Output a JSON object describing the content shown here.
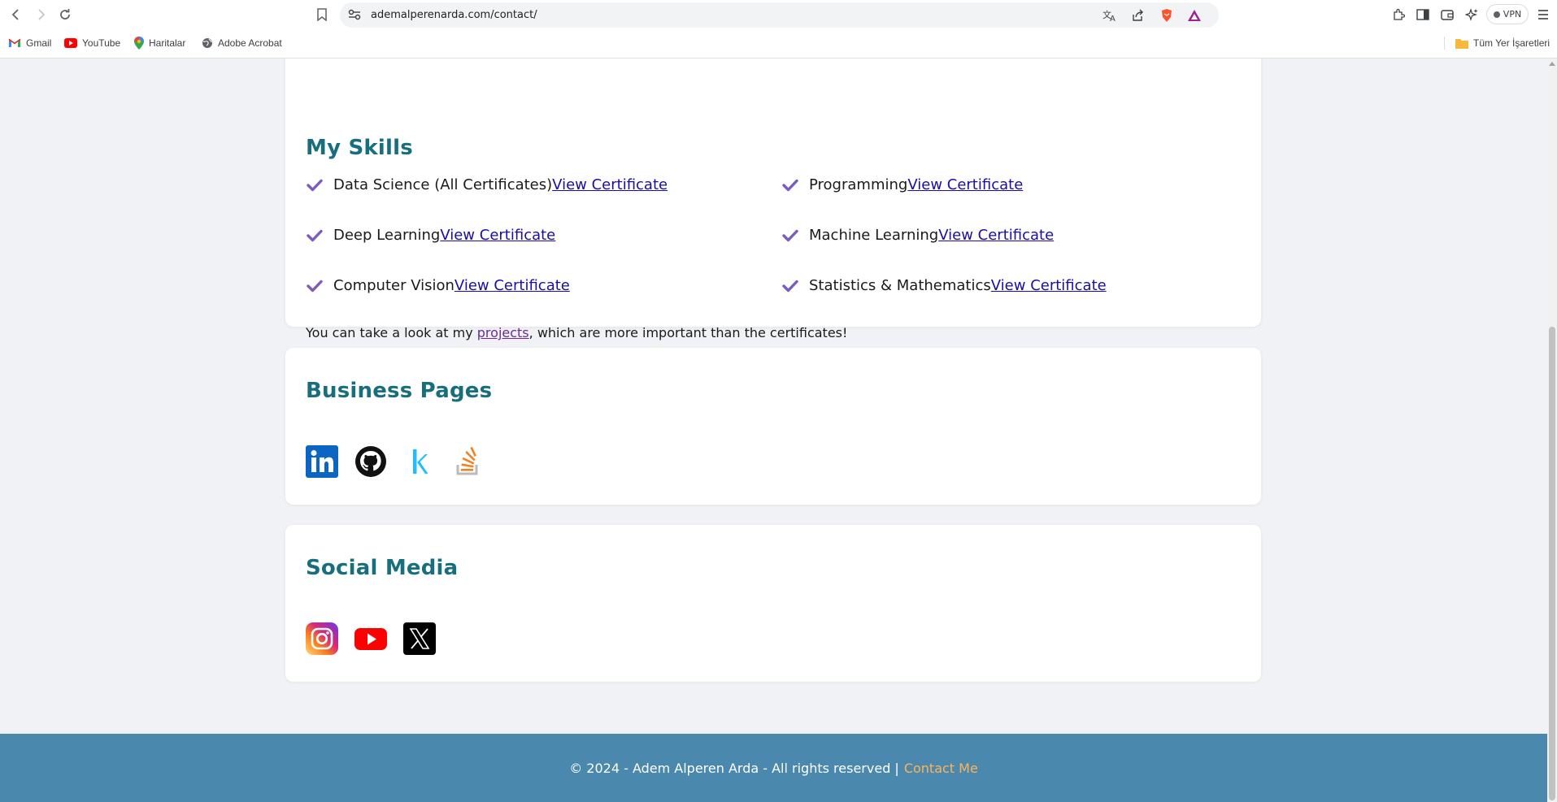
{
  "browser": {
    "url": "ademalperenarda.com/contact/",
    "vpn_label": "VPN",
    "bookmarks": [
      {
        "label": "Gmail"
      },
      {
        "label": "YouTube"
      },
      {
        "label": "Haritalar"
      },
      {
        "label": "Adobe Acrobat"
      }
    ],
    "all_bookmarks_label": "Tüm Yer İşaretleri"
  },
  "skills": {
    "title": "My Skills",
    "items": [
      {
        "name": "Data Science (All Certificates)",
        "link": "View Certificate"
      },
      {
        "name": "Programming",
        "link": "View Certificate"
      },
      {
        "name": "Deep Learning",
        "link": "View Certificate"
      },
      {
        "name": "Machine Learning",
        "link": "View Certificate"
      },
      {
        "name": "Computer Vision",
        "link": "View Certificate"
      },
      {
        "name": "Statistics & Mathematics",
        "link": "View Certificate"
      }
    ],
    "note_prefix": "You can take a look at my ",
    "note_link": "projects",
    "note_suffix": ", which are more important than the certificates!"
  },
  "business": {
    "title": "Business Pages",
    "icons": [
      "linkedin-icon",
      "github-icon",
      "kaggle-icon",
      "stackoverflow-icon"
    ]
  },
  "social": {
    "title": "Social Media",
    "icons": [
      "instagram-icon",
      "youtube-icon",
      "x-icon"
    ]
  },
  "footer": {
    "text": "© 2024 - Adem Alperen Arda - All rights reserved |",
    "contact_link": "Contact Me"
  },
  "colors": {
    "heading": "#176f7d",
    "check": "#7a5bbf",
    "link": "#1a0dab",
    "footer_bg": "#4a89ad",
    "footer_link": "#ffb25b"
  }
}
